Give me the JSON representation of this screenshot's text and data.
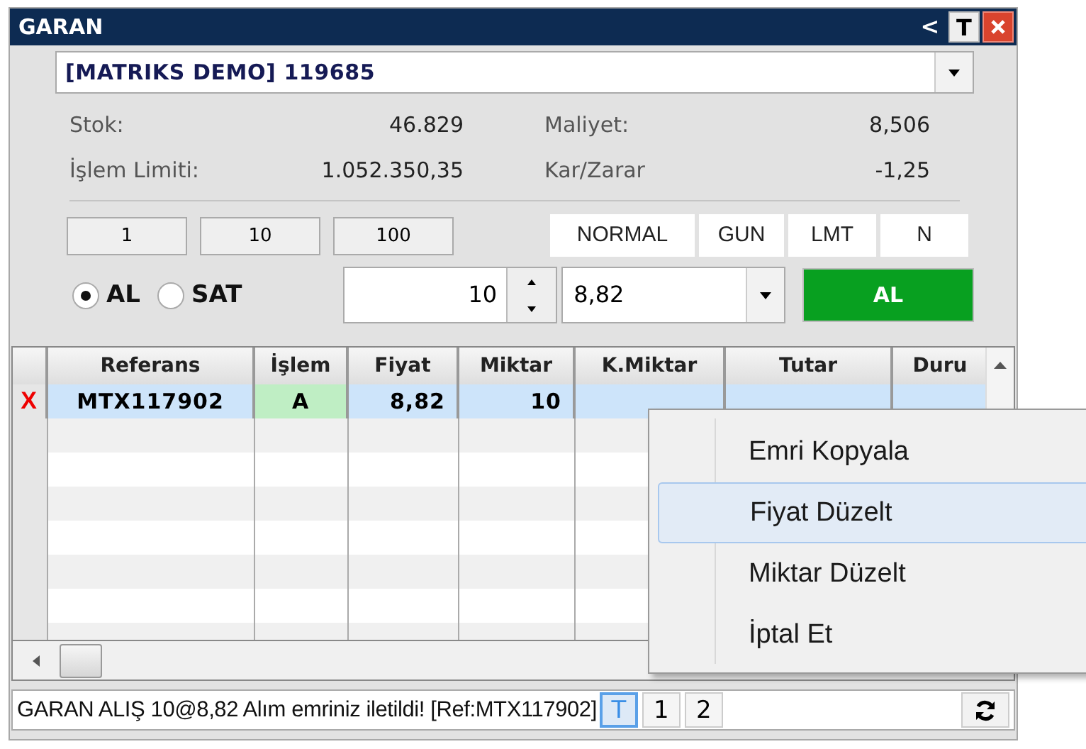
{
  "window": {
    "title": "GARAN",
    "title_buttons": [
      "<",
      "T"
    ]
  },
  "account": {
    "value": "[MATRIKS DEMO] 119685"
  },
  "info": [
    {
      "label": "Stok:",
      "value": "46.829"
    },
    {
      "label": "Maliyet:",
      "value": "8,506"
    },
    {
      "label": "İşlem Limiti:",
      "value": "1.052.350,35"
    },
    {
      "label": "Kar/Zarar",
      "value": "-1,25"
    }
  ],
  "quantity_buttons": [
    "1",
    "10",
    "100"
  ],
  "order_options": [
    "NORMAL",
    "GUN",
    "LMT",
    "N"
  ],
  "sides": [
    {
      "label": "AL",
      "selected": true
    },
    {
      "label": "SAT",
      "selected": false
    }
  ],
  "quantity": {
    "value": "10"
  },
  "price": {
    "value": "8,82"
  },
  "submit_button": "AL",
  "table": {
    "columns": [
      "Referans",
      "İşlem",
      "Fiyat",
      "Miktar",
      "K.Miktar",
      "Tutar",
      "Duru"
    ],
    "rows": [
      {
        "cancel": "X",
        "cells": [
          "MTX117902",
          "A",
          "8,82",
          "10"
        ],
        "selected": true
      }
    ]
  },
  "context_menu": [
    {
      "label": "Emri Kopyala",
      "selected": false
    },
    {
      "label": "Fiyat Düzelt",
      "selected": true
    },
    {
      "label": "Miktar Düzelt",
      "selected": false
    },
    {
      "label": "İptal Et",
      "selected": false
    }
  ],
  "status_bar": {
    "message": "GARAN ALIŞ 10@8,82 Alım emriniz iletildi! [Ref:MTX117902]",
    "tabs": [
      {
        "label": "T",
        "selected": true
      },
      {
        "label": "1",
        "selected": false
      },
      {
        "label": "2",
        "selected": false
      }
    ]
  }
}
